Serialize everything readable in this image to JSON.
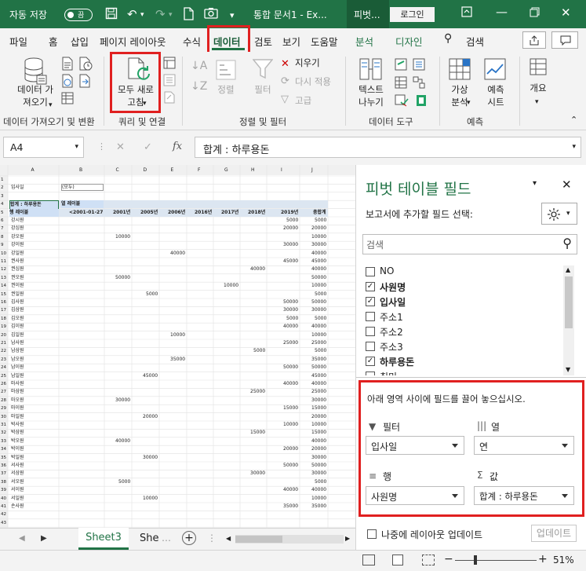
{
  "titlebar": {
    "autosave": "자동 저장",
    "autosave_state": "끔",
    "title": "통합 문서1 - Ex...",
    "pivot_tab": "피벗...",
    "login": "로그인",
    "qat_more": "▾"
  },
  "tabs": [
    "파일",
    "홈",
    "삽입",
    "페이지 레이아웃",
    "수식",
    "데이터",
    "검토",
    "보기",
    "도움말",
    "분석",
    "디자인"
  ],
  "tell_me": "검색",
  "ribbon": {
    "get_data": "데이터 가\n져오기",
    "refresh_all": "모두 새로\n고침",
    "sort": "정렬",
    "filter": "필터",
    "clear": "지우기",
    "reapply": "다시 적용",
    "advanced": "고급",
    "text_to_columns": "텍스트\n나누기",
    "what_if": "가상\n분석",
    "forecast_sheet": "예측\n시트",
    "outline": "개요",
    "groups": {
      "get_transform": "데이터 가져오기 및 변환",
      "queries": "쿼리 및 연결",
      "sort_filter": "정렬 및 필터",
      "data_tools": "데이터 도구",
      "forecast": "예측"
    }
  },
  "formula": {
    "namebox": "A4",
    "content": "합계 : 하루용돈"
  },
  "sheet": {
    "columns": [
      "A",
      "B",
      "C",
      "D",
      "E",
      "F",
      "G",
      "H",
      "I",
      "J"
    ],
    "filter_label": "입사일",
    "filter_value": "(모두)",
    "pivot_corner": "합계 : 하루용돈",
    "col_label": "열 레이블",
    "row_label": "행 레이블",
    "headers": [
      "<2001-01-27",
      "2001년",
      "2005년",
      "2006년",
      "2016년",
      "2017년",
      "2018년",
      "2019년",
      "총합계"
    ],
    "rows": [
      {
        "n": "강시원",
        "v": [
          "",
          "",
          "",
          "",
          "",
          "",
          "",
          "5000",
          "5000"
        ]
      },
      {
        "n": "강심원",
        "v": [
          "",
          "",
          "",
          "",
          "",
          "",
          "",
          "20000",
          "20000"
        ]
      },
      {
        "n": "강오원",
        "v": [
          "",
          "10000",
          "",
          "",
          "",
          "",
          "",
          "",
          "10000"
        ]
      },
      {
        "n": "강이원",
        "v": [
          "",
          "",
          "",
          "",
          "",
          "",
          "",
          "30000",
          "30000"
        ]
      },
      {
        "n": "강일원",
        "v": [
          "",
          "",
          "",
          "40000",
          "",
          "",
          "",
          "",
          "40000"
        ]
      },
      {
        "n": "권사원",
        "v": [
          "",
          "",
          "",
          "",
          "",
          "",
          "",
          "45000",
          "45000"
        ]
      },
      {
        "n": "권심원",
        "v": [
          "",
          "",
          "",
          "",
          "",
          "",
          "40000",
          "",
          "40000"
        ]
      },
      {
        "n": "권오원",
        "v": [
          "",
          "50000",
          "",
          "",
          "",
          "",
          "",
          "",
          "50000"
        ]
      },
      {
        "n": "권이원",
        "v": [
          "",
          "",
          "",
          "",
          "",
          "10000",
          "",
          "",
          "10000"
        ]
      },
      {
        "n": "권일원",
        "v": [
          "",
          "",
          "5000",
          "",
          "",
          "",
          "",
          "",
          "5000"
        ]
      },
      {
        "n": "김사원",
        "v": [
          "",
          "",
          "",
          "",
          "",
          "",
          "",
          "50000",
          "50000"
        ]
      },
      {
        "n": "김삼원",
        "v": [
          "",
          "",
          "",
          "",
          "",
          "",
          "",
          "30000",
          "30000"
        ]
      },
      {
        "n": "김오원",
        "v": [
          "",
          "",
          "",
          "",
          "",
          "",
          "",
          "5000",
          "5000"
        ]
      },
      {
        "n": "김이원",
        "v": [
          "",
          "",
          "",
          "",
          "",
          "",
          "",
          "40000",
          "40000"
        ]
      },
      {
        "n": "김일원",
        "v": [
          "",
          "",
          "",
          "10000",
          "",
          "",
          "",
          "",
          "10000"
        ]
      },
      {
        "n": "남사원",
        "v": [
          "",
          "",
          "",
          "",
          "",
          "",
          "",
          "25000",
          "25000"
        ]
      },
      {
        "n": "남삼원",
        "v": [
          "",
          "",
          "",
          "",
          "",
          "",
          "5000",
          "",
          "5000"
        ]
      },
      {
        "n": "남오원",
        "v": [
          "",
          "",
          "",
          "35000",
          "",
          "",
          "",
          "",
          "35000"
        ]
      },
      {
        "n": "남이원",
        "v": [
          "",
          "",
          "",
          "",
          "",
          "",
          "",
          "50000",
          "50000"
        ]
      },
      {
        "n": "남일원",
        "v": [
          "",
          "",
          "45000",
          "",
          "",
          "",
          "",
          "",
          "45000"
        ]
      },
      {
        "n": "마사원",
        "v": [
          "",
          "",
          "",
          "",
          "",
          "",
          "",
          "40000",
          "40000"
        ]
      },
      {
        "n": "마삼원",
        "v": [
          "",
          "",
          "",
          "",
          "",
          "",
          "25000",
          "",
          "25000"
        ]
      },
      {
        "n": "마오원",
        "v": [
          "",
          "30000",
          "",
          "",
          "",
          "",
          "",
          "",
          "30000"
        ]
      },
      {
        "n": "마이원",
        "v": [
          "",
          "",
          "",
          "",
          "",
          "",
          "",
          "15000",
          "15000"
        ]
      },
      {
        "n": "마일원",
        "v": [
          "",
          "",
          "20000",
          "",
          "",
          "",
          "",
          "",
          "20000"
        ]
      },
      {
        "n": "박사원",
        "v": [
          "",
          "",
          "",
          "",
          "",
          "",
          "",
          "10000",
          "10000"
        ]
      },
      {
        "n": "박삼원",
        "v": [
          "",
          "",
          "",
          "",
          "",
          "",
          "15000",
          "",
          "15000"
        ]
      },
      {
        "n": "박오원",
        "v": [
          "",
          "40000",
          "",
          "",
          "",
          "",
          "",
          "",
          "40000"
        ]
      },
      {
        "n": "박이원",
        "v": [
          "",
          "",
          "",
          "",
          "",
          "",
          "",
          "20000",
          "20000"
        ]
      },
      {
        "n": "박일원",
        "v": [
          "",
          "",
          "30000",
          "",
          "",
          "",
          "",
          "",
          "30000"
        ]
      },
      {
        "n": "서사원",
        "v": [
          "",
          "",
          "",
          "",
          "",
          "",
          "",
          "50000",
          "50000"
        ]
      },
      {
        "n": "서삼원",
        "v": [
          "",
          "",
          "",
          "",
          "",
          "",
          "30000",
          "",
          "30000"
        ]
      },
      {
        "n": "서오원",
        "v": [
          "",
          "5000",
          "",
          "",
          "",
          "",
          "",
          "",
          "5000"
        ]
      },
      {
        "n": "서이원",
        "v": [
          "",
          "",
          "",
          "",
          "",
          "",
          "",
          "40000",
          "40000"
        ]
      },
      {
        "n": "서일원",
        "v": [
          "",
          "",
          "10000",
          "",
          "",
          "",
          "",
          "",
          "10000"
        ]
      },
      {
        "n": "손사원",
        "v": [
          "",
          "",
          "",
          "",
          "",
          "",
          "",
          "35000",
          "35000"
        ]
      }
    ]
  },
  "sheet_tabs": {
    "active": "Sheet3",
    "other": "She"
  },
  "panel": {
    "title": "피벗 테이블 필드",
    "subtitle": "보고서에 추가할 필드 선택:",
    "search_placeholder": "검색",
    "fields": [
      {
        "name": "NO",
        "checked": false
      },
      {
        "name": "사원명",
        "checked": true
      },
      {
        "name": "입사일",
        "checked": true
      },
      {
        "name": "주소1",
        "checked": false
      },
      {
        "name": "주소2",
        "checked": false
      },
      {
        "name": "주소3",
        "checked": false
      },
      {
        "name": "하루용돈",
        "checked": true
      },
      {
        "name": "취미",
        "checked": false
      }
    ],
    "drag_hint": "아래 영역 사이에 필드를 끌어 놓으십시오.",
    "areas": {
      "filter_title": "필터",
      "filter_value": "입사일",
      "columns_title": "열",
      "columns_value": "연",
      "rows_title": "행",
      "rows_value": "사원명",
      "values_title": "값",
      "values_value": "합계 : 하루용돈"
    },
    "defer_label": "나중에 레이아웃 업데이트",
    "update_button": "업데이트"
  },
  "status": {
    "zoom": "51%"
  }
}
